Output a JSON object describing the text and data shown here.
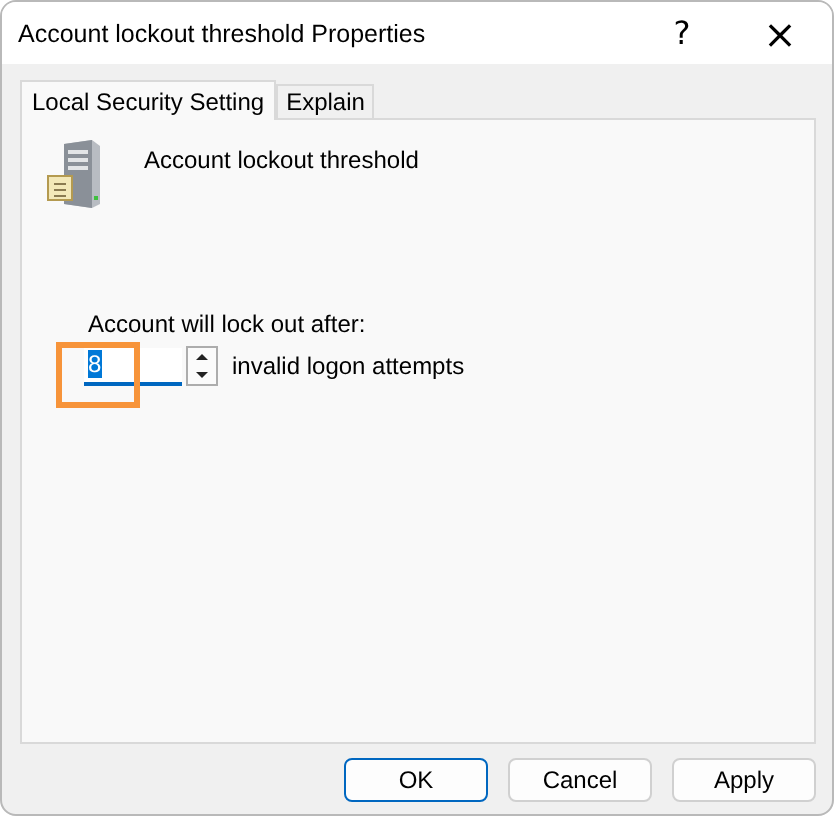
{
  "window": {
    "title": "Account lockout threshold Properties",
    "help": "?",
    "close": "×"
  },
  "tabs": [
    {
      "label": "Local Security Setting",
      "selected": true
    },
    {
      "label": "Explain",
      "selected": false
    }
  ],
  "policy": {
    "name": "Account lockout threshold"
  },
  "setting": {
    "label": "Account will lock out after:",
    "value": "8",
    "value_selected": true,
    "unit": "invalid logon attempts"
  },
  "buttons": [
    {
      "label": "OK",
      "default": true
    },
    {
      "label": "Cancel",
      "default": false
    },
    {
      "label": "Apply",
      "default": false
    }
  ]
}
